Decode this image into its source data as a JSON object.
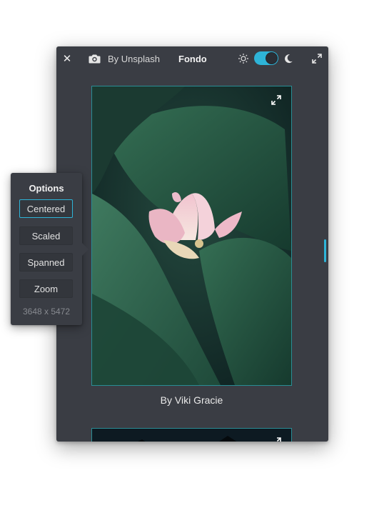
{
  "header": {
    "close_icon": "close-icon",
    "camera_icon": "camera-icon",
    "source_label": "By Unsplash",
    "title": "Fondo",
    "sun_icon": "sun-icon",
    "moon_icon": "moon-icon",
    "dark_mode_on": true,
    "expand_icon": "expand-icon"
  },
  "gallery": {
    "items": [
      {
        "caption": "By Viki Gracie",
        "expand_icon": "expand-icon"
      },
      {
        "caption": "",
        "expand_icon": "expand-icon"
      }
    ]
  },
  "options": {
    "title": "Options",
    "buttons": [
      "Centered",
      "Scaled",
      "Spanned",
      "Zoom"
    ],
    "selected": "Centered",
    "resolution": "3648 x 5472"
  },
  "colors": {
    "accent": "#2eb4d8",
    "window_bg": "#3a3d44",
    "text": "#e9e9e9"
  }
}
